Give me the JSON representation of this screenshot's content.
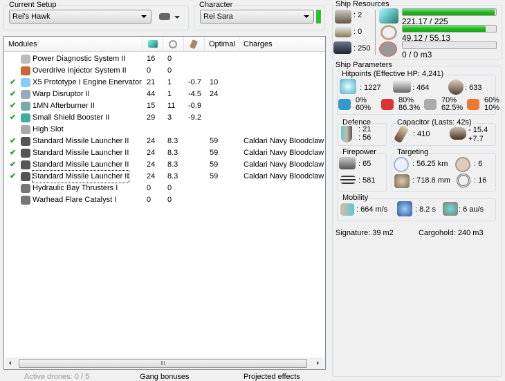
{
  "setup": {
    "title": "Current Setup",
    "value": "Rei's Hawk"
  },
  "character": {
    "title": "Character",
    "value": "Rei Sara",
    "status_color": "#00e000"
  },
  "modules": {
    "headers": [
      "Modules",
      "cpu-icon",
      "powergrid-icon",
      "capacitor-icon",
      "Optimal",
      "Charges"
    ],
    "rows": [
      {
        "checked": false,
        "icon": "power-diagnostic-icon",
        "name": "Power Diagnostic System II",
        "cpu": "16",
        "pg": "0",
        "cap": "",
        "optimal": "",
        "charges": ""
      },
      {
        "checked": false,
        "icon": "overdrive-icon",
        "name": "Overdrive Injector System II",
        "cpu": "0",
        "pg": "0",
        "cap": "",
        "optimal": "",
        "charges": ""
      },
      {
        "checked": true,
        "icon": "scrambler-icon",
        "name": "X5 Prototype I Engine Enervator",
        "cpu": "21",
        "pg": "1",
        "cap": "-0.7",
        "optimal": "10",
        "charges": ""
      },
      {
        "checked": true,
        "icon": "disruptor-icon",
        "name": "Warp Disruptor II",
        "cpu": "44",
        "pg": "1",
        "cap": "-4.5",
        "optimal": "24",
        "charges": ""
      },
      {
        "checked": true,
        "icon": "afterburner-icon",
        "name": "1MN Afterburner II",
        "cpu": "15",
        "pg": "11",
        "cap": "-0.9",
        "optimal": "",
        "charges": ""
      },
      {
        "checked": true,
        "icon": "shield-booster-icon",
        "name": "Small Shield Booster II",
        "cpu": "29",
        "pg": "3",
        "cap": "-9.2",
        "optimal": "",
        "charges": ""
      },
      {
        "checked": false,
        "icon": "high-slot-icon",
        "name": "High Slot",
        "cpu": "",
        "pg": "",
        "cap": "",
        "optimal": "",
        "charges": ""
      },
      {
        "checked": true,
        "icon": "launcher-icon",
        "name": "Standard Missile Launcher II",
        "cpu": "24",
        "pg": "8.3",
        "cap": "",
        "optimal": "59",
        "charges": "Caldari Navy Bloodclaw"
      },
      {
        "checked": true,
        "icon": "launcher-icon",
        "name": "Standard Missile Launcher II",
        "cpu": "24",
        "pg": "8.3",
        "cap": "",
        "optimal": "59",
        "charges": "Caldari Navy Bloodclaw"
      },
      {
        "checked": true,
        "icon": "launcher-icon",
        "name": "Standard Missile Launcher II",
        "cpu": "24",
        "pg": "8.3",
        "cap": "",
        "optimal": "59",
        "charges": "Caldari Navy Bloodclaw"
      },
      {
        "checked": true,
        "icon": "launcher-icon",
        "name": "Standard Missile Launcher II",
        "cpu": "24",
        "pg": "8.3",
        "cap": "",
        "optimal": "59",
        "charges": "Caldari Navy Bloodclaw"
      },
      {
        "checked": false,
        "icon": "rig-icon",
        "name": "Hydraulic Bay Thrusters I",
        "cpu": "0",
        "pg": "0",
        "cap": "",
        "optimal": "",
        "charges": ""
      },
      {
        "checked": false,
        "icon": "rig-icon",
        "name": "Warhead Flare Catalyst I",
        "cpu": "0",
        "pg": "0",
        "cap": "",
        "optimal": "",
        "charges": ""
      }
    ]
  },
  "footer": {
    "drones": "Active drones: 0 / 5",
    "gang": "Gang bonuses",
    "projected": "Projected effects"
  },
  "resources": {
    "title": "Ship Resources",
    "turrets": ": 2",
    "launchers": ": 0",
    "calibration": ": 250",
    "cpu": {
      "text": "221.17 / 225",
      "fraction": 0.983
    },
    "pg": {
      "text": "49.12 / 55.13",
      "fraction": 0.891
    },
    "drone_bay": {
      "text": "0 / 0 m3",
      "fraction": 0
    }
  },
  "params": {
    "title": "Ship Parameters",
    "hp_title": "Hitpoints (Effective HP: 4,241)",
    "shield": ": 1227",
    "armor": ": 464",
    "structure": ": 633",
    "resists": [
      {
        "icon": "em-icon",
        "a": "0%",
        "b": "60%"
      },
      {
        "icon": "thermal-icon",
        "a": "80%",
        "b": "86.3%"
      },
      {
        "icon": "kinetic-icon",
        "a": "70%",
        "b": "62.5%"
      },
      {
        "icon": "explosive-icon",
        "a": "60%",
        "b": "10%"
      }
    ],
    "defence_title": "Defence",
    "defence_a": ": 21",
    "defence_b": ": 56",
    "cap_title": "Capacitor (Lasts: 42s)",
    "cap_amount": ": 410",
    "cap_use": "- 15.4",
    "cap_regen": "+7.7",
    "fire_title": "Firepower",
    "dps": ": 65",
    "volley": ": 581",
    "target_title": "Targeting",
    "range": ": 56.25 km",
    "max_targets": ": 6",
    "scan_res": ": 718.8 mm",
    "sensor": ": 16",
    "mob_title": "Mobility",
    "speed": ": 664 m/s",
    "align": ": 8.2 s",
    "warp": ": 6 au/s",
    "signature": "Signature: 39 m2",
    "cargo": "Cargohold: 240 m3"
  }
}
